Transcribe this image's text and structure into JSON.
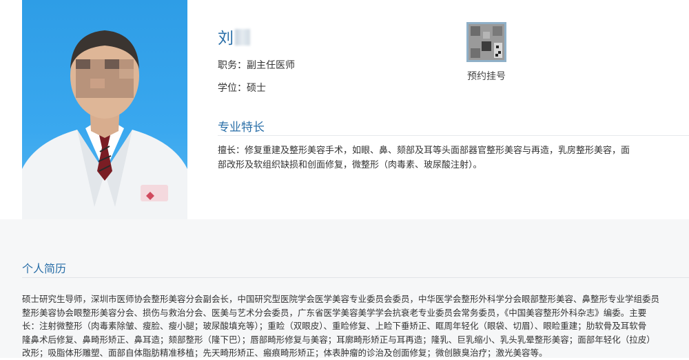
{
  "doctor": {
    "name": "刘",
    "title_label": "职务：副主任医师",
    "degree_label": "学位：硕士"
  },
  "booking": {
    "label": "预约挂号"
  },
  "specialty": {
    "heading": "专业特长",
    "text_lines": [
      "擅长：修复重建及整形美容手术，如眼、鼻、颏部及耳等头面部器官整形美容与再造，乳房整形美容，面",
      "部改形及软组织缺损和创面修复，微整形（肉毒素、玻尿酸注射）。"
    ]
  },
  "bio": {
    "heading": "个人简历",
    "text_lines": [
      "硕士研究生导师，深圳市医师协会整形美容分会副会长，中国研究型医院学会医学美容专业委员会委员，中华医学会整形外科学分会眼部整形美容、鼻整形专业学组委员",
      "整形美容协会眼整形美容分会、损伤与救治分会、医美与艺术分会委员，广东省医学美容美学学会抗衰老专业委员会常务委员，《中国美容整形外科杂志》编委。主要",
      "长：注射微整形（肉毒素除皱、瘦脸、瘦小腿；玻尿酸填充等）；重睑（双眼皮）、重睑修复、上睑下垂矫正、眶周年轻化（眼袋、切眉）、眼睑重建；肋软骨及耳软骨",
      "隆鼻术后修复、鼻畸形矫正、鼻耳造；颏部整形（隆下巴）；唇部畸形修复与美容；耳廓畸形矫正与耳再造；隆乳、巨乳缩小、乳头乳晕整形美容；面部年轻化（拉皮）",
      "改形；吸脂体形雕塑、面部自体脂肪精准移植；先天畸形矫正、瘢痕畸形矫正；体表肿瘤的诊治及创面修复；微创腋臭治疗；激光美容等。"
    ]
  },
  "colors": {
    "accent": "#2a6fa8",
    "photo_bg": "#3aa8ef",
    "bottom_bg": "#f6f7f8"
  }
}
